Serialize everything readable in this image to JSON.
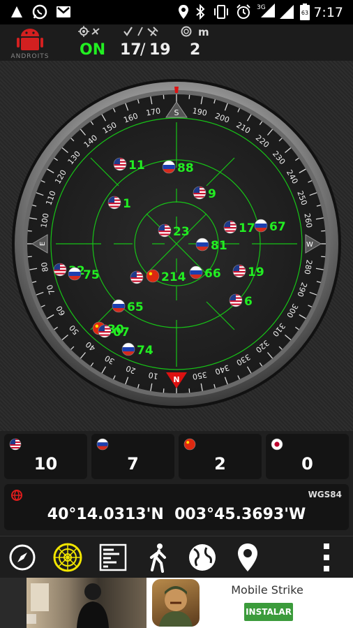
{
  "status_bar": {
    "time": "7:17",
    "icons": [
      "up-arrow-icon",
      "whatsapp-icon",
      "gmail-icon",
      "location-icon",
      "bluetooth-icon",
      "vibrate-icon",
      "alarm-icon",
      "signal-3g-icon",
      "signal-icon",
      "battery-icon"
    ],
    "network": "3G",
    "battery": "63"
  },
  "header": {
    "app": "ANDROITS",
    "gps_state": "ON",
    "sats_used": "17",
    "sats_sep": "/",
    "sats_total": "19",
    "accuracy_unit": "m",
    "accuracy": "2"
  },
  "compass": {
    "north": "N",
    "south": "S",
    "east": "E",
    "west": "W",
    "degree_labels": [
      "10",
      "20",
      "30",
      "40",
      "50",
      "60",
      "70",
      "80",
      "100",
      "110",
      "120",
      "130",
      "140",
      "150",
      "160",
      "170",
      "190",
      "200",
      "210",
      "220",
      "230",
      "240",
      "250",
      "260",
      "280",
      "290",
      "300",
      "310",
      "320",
      "330",
      "340",
      "350"
    ]
  },
  "satellites": [
    {
      "id": "11",
      "flag": "us"
    },
    {
      "id": "88",
      "flag": "ru"
    },
    {
      "id": "9",
      "flag": "us"
    },
    {
      "id": "1",
      "flag": "us"
    },
    {
      "id": "23",
      "flag": "us"
    },
    {
      "id": "17",
      "flag": "us"
    },
    {
      "id": "67",
      "flag": "ru"
    },
    {
      "id": "81",
      "flag": "ru"
    },
    {
      "id": "32",
      "flag": "us"
    },
    {
      "id": "75",
      "flag": "ru"
    },
    {
      "id": "",
      "flag": "us"
    },
    {
      "id": "214",
      "flag": "cn"
    },
    {
      "id": "66",
      "flag": "ru"
    },
    {
      "id": "19",
      "flag": "us"
    },
    {
      "id": "6",
      "flag": "us"
    },
    {
      "id": "65",
      "flag": "ru"
    },
    {
      "id": "30",
      "flag": "cn"
    },
    {
      "id": "07",
      "flag": "us"
    },
    {
      "id": "74",
      "flag": "ru"
    }
  ],
  "constellations": [
    {
      "name": "gps",
      "flag": "us",
      "count": "10"
    },
    {
      "name": "glonass",
      "flag": "ru",
      "count": "7"
    },
    {
      "name": "beidou",
      "flag": "cn",
      "count": "2"
    },
    {
      "name": "qzss",
      "flag": "jp",
      "count": "0"
    }
  ],
  "position": {
    "datum": "WGS84",
    "lat": "40°14.0313'N",
    "lon": "003°45.3693'W"
  },
  "toolbar": {
    "items": [
      "compass-icon",
      "radar-icon",
      "signal-bars-icon",
      "walk-icon",
      "globe-icon",
      "map-pin-icon",
      "more-icon"
    ]
  },
  "ad": {
    "title": "Mobile Strike",
    "button": "INSTALAR"
  },
  "colors": {
    "accent": "#00e600",
    "green_text": "#22ee22",
    "card_bg": "#141414"
  }
}
